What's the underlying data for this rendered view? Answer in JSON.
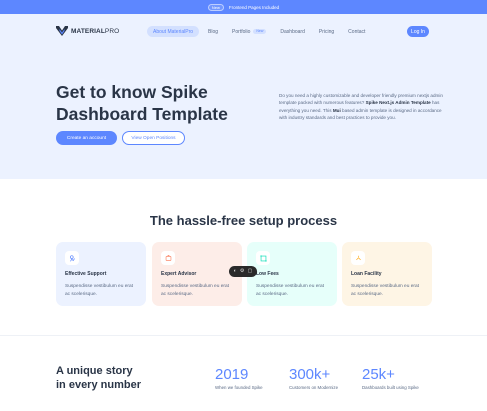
{
  "announcement": {
    "badge": "New",
    "text": "Frontend Pages Included"
  },
  "brand": {
    "name_bold": "MATERIAL",
    "name_light": "PRO",
    "logo_icon": "materialpro-logo-icon"
  },
  "nav": {
    "items": [
      {
        "label": "About MaterialPro",
        "active": true
      },
      {
        "label": "Blog"
      },
      {
        "label": "Portfolio",
        "pill": "New"
      },
      {
        "label": "Dashboard"
      },
      {
        "label": "Pricing"
      },
      {
        "label": "Contact"
      }
    ],
    "login_label": "Log In"
  },
  "hero": {
    "title_line1": "Get to know Spike",
    "title_line2": "Dashboard Template",
    "desc_part1": "Do you need a highly customizable and developer friendly premium nextjs admin template packed with numerous features?",
    "desc_bold1": "Spike Next.js Admin Template",
    "desc_part2": "has everything you need. This",
    "desc_bold2": "Mui",
    "desc_part3": "based admin template is designed in accordance with industry standards and best practices to provide you.",
    "primary_button": "Create an account",
    "secondary_button": "View Open Positions"
  },
  "setup": {
    "title": "The hassle-free setup process",
    "cards": [
      {
        "title": "Effective Support",
        "desc": "Suspendisse vestibulum eu erat ac scelerisque.",
        "icon": "support-icon"
      },
      {
        "title": "Expert Advisor",
        "desc": "Suspendisse vestibulum eu erat ac scelerisque.",
        "icon": "advisor-icon"
      },
      {
        "title": "Low Fees",
        "desc": "Suspendisse vestibulum eu erat ac scelerisque.",
        "icon": "fees-icon"
      },
      {
        "title": "Loan Facility",
        "desc": "Suspendisse vestibulum eu erat ac scelerisque.",
        "icon": "loan-icon"
      }
    ]
  },
  "stats": {
    "title_line1": "A unique story",
    "title_line2": "in every number",
    "items": [
      {
        "value": "2019",
        "label": "When we founded Spike"
      },
      {
        "value": "300k+",
        "label": "Customers on Modernize"
      },
      {
        "value": "25k+",
        "label": "Dashboards built using Spike"
      }
    ]
  },
  "colors": {
    "primary": "#5d87ff",
    "hero_bg": "#ecf2ff",
    "text_dark": "#2a3547"
  }
}
